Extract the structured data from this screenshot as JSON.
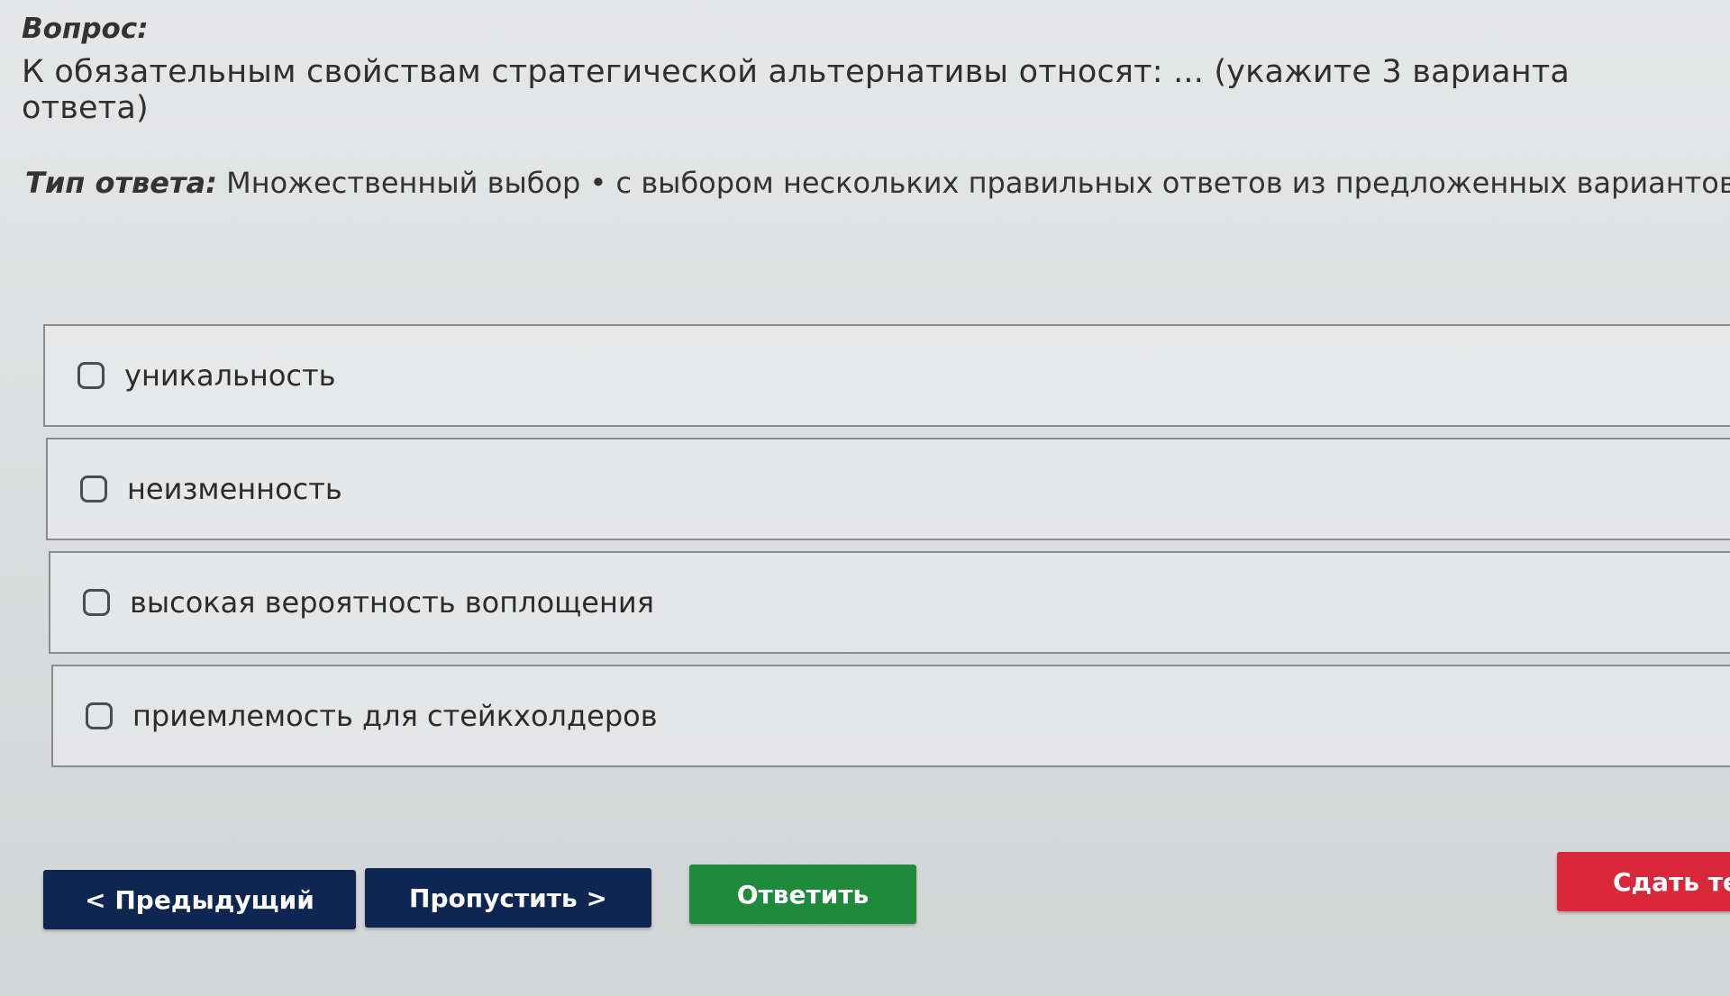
{
  "question": {
    "heading": "Вопрос:",
    "text": "К обязательным свойствам стратегической альтернативы относят: ... (укажите 3 варианта ответа)"
  },
  "answer_type": {
    "label": "Тип ответа:",
    "value": "Множественный выбор • с выбором нескольких правильных ответов из предложенных вариантов"
  },
  "options": [
    {
      "label": "уникальность",
      "checked": false
    },
    {
      "label": "неизменность",
      "checked": false
    },
    {
      "label": "высокая вероятность воплощения",
      "checked": false
    },
    {
      "label": "приемлемость для стейкхолдеров",
      "checked": false
    }
  ],
  "buttons": {
    "previous": "< Предыдущий",
    "skip": "Пропустить >",
    "answer": "Ответить",
    "submit": "Сдать тес"
  },
  "colors": {
    "navy_button": "#0f2552",
    "green_button": "#1f8a3b",
    "red_button": "#d8283a"
  }
}
